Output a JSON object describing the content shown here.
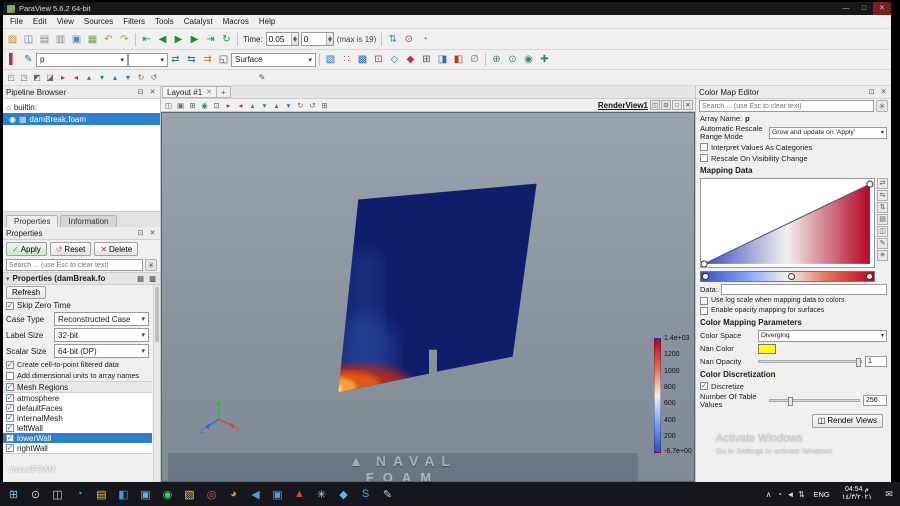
{
  "window": {
    "title": "ParaView 5.6.2 64-bit",
    "menus": [
      "File",
      "Edit",
      "View",
      "Sources",
      "Filters",
      "Tools",
      "Catalyst",
      "Macros",
      "Help"
    ]
  },
  "icons": {
    "minimize": "—",
    "maximize": "□",
    "close": "✕",
    "pin": "⊡",
    "gear": "✳",
    "collapse": "▾",
    "copy": "▤",
    "paste": "▥",
    "eye": "◉",
    "server": "⌂",
    "reader": "▦",
    "tab_close": "✕",
    "tab_plus": "+",
    "apply": "✓",
    "reset": "↺",
    "delete": "✕",
    "render_views": "◫",
    "naval_logo": "▲",
    "notification": "✉"
  },
  "toolbar1": {
    "file_icons": [
      {
        "name": "open-file-icon",
        "glyph": "▨",
        "color": "#c98a2c"
      },
      {
        "name": "save-data-icon",
        "glyph": "◫",
        "color": "#5b7fb4"
      },
      {
        "name": "save-state-icon",
        "glyph": "▤",
        "color": "#8a8a8a"
      },
      {
        "name": "load-state-icon",
        "glyph": "▥",
        "color": "#8a8a8a"
      },
      {
        "name": "save-screenshot-icon",
        "glyph": "▣",
        "color": "#4e86c8"
      },
      {
        "name": "save-animation-icon",
        "glyph": "▦",
        "color": "#76a23e"
      },
      {
        "name": "undo-icon",
        "glyph": "↶",
        "color": "#b9982e"
      },
      {
        "name": "redo-icon",
        "glyph": "↷",
        "color": "#b9982e"
      }
    ],
    "vcr_icons": [
      {
        "name": "first-frame-button",
        "glyph": "⇤",
        "color": "#1f8a3d"
      },
      {
        "name": "previous-frame-button",
        "glyph": "◀",
        "color": "#1f8a3d"
      },
      {
        "name": "play-button",
        "glyph": "▶",
        "color": "#1f8a3d"
      },
      {
        "name": "next-frame-button",
        "glyph": "▶",
        "color": "#1f8a3d"
      },
      {
        "name": "last-frame-button",
        "glyph": "⇥",
        "color": "#1f8a3d"
      },
      {
        "name": "loop-button",
        "glyph": "↻",
        "color": "#1f8a3d"
      }
    ],
    "time_label": "Time:",
    "time_value": "0.05",
    "frame_value": "0",
    "max_label": "(max is 19)",
    "extra_icons": [
      {
        "name": "snap-to-timesteps-icon",
        "glyph": "⇅",
        "color": "#4e86c8"
      },
      {
        "name": "find-data-icon",
        "glyph": "⊙",
        "color": "#b03a2e"
      },
      {
        "name": "time-inspector-icon",
        "glyph": "◔",
        "color": "#4e86c8"
      }
    ]
  },
  "toolbar2": {
    "left_icons": [
      {
        "name": "toggle-color-legend-icon",
        "glyph": "▌",
        "color": "#b03a2e"
      },
      {
        "name": "edit-color-map-icon",
        "glyph": "✎",
        "color": "#2e6db0"
      }
    ],
    "array_value": "p",
    "component_value": "",
    "scalarbar_icons": [
      {
        "name": "rescale-to-data-range-icon",
        "glyph": "⇄",
        "color": "#2e8b57"
      },
      {
        "name": "rescale-to-custom-range-icon",
        "glyph": "⇆",
        "color": "#2e6db0"
      },
      {
        "name": "rescale-over-time-icon",
        "glyph": "⇉",
        "color": "#b9772e"
      },
      {
        "name": "rescale-to-visible-range-icon",
        "glyph": "◱",
        "color": "#555555"
      }
    ],
    "representation_value": "Surface",
    "selection_icons": [
      {
        "name": "select-cells-on-surface-icon",
        "glyph": "▧",
        "color": "#2e6db0"
      },
      {
        "name": "select-points-on-surface-icon",
        "glyph": "∷",
        "color": "#b03a2e"
      },
      {
        "name": "select-cells-through-icon",
        "glyph": "▩",
        "color": "#2e6db0"
      },
      {
        "name": "select-points-through-icon",
        "glyph": "⊡",
        "color": "#b03a2e"
      },
      {
        "name": "select-cells-polygon-icon",
        "glyph": "◇",
        "color": "#2e6db0"
      },
      {
        "name": "select-points-polygon-icon",
        "glyph": "◆",
        "color": "#b03a2e"
      },
      {
        "name": "select-block-icon",
        "glyph": "⊞",
        "color": "#555555"
      },
      {
        "name": "interactive-select-cells-icon",
        "glyph": "◨",
        "color": "#2e6db0"
      },
      {
        "name": "interactive-select-points-icon",
        "glyph": "◧",
        "color": "#b03a2e"
      },
      {
        "name": "clear-selection-icon",
        "glyph": "∅",
        "color": "#777777"
      }
    ],
    "camera_icons": [
      {
        "name": "zoom-to-data-icon",
        "glyph": "⊕",
        "color": "#2e8b57"
      },
      {
        "name": "zoom-closest-icon",
        "glyph": "⊙",
        "color": "#2e8b57"
      },
      {
        "name": "reset-camera-icon",
        "glyph": "◉",
        "color": "#2e8b57"
      },
      {
        "name": "set-center-of-rotation-icon",
        "glyph": "✚",
        "color": "#2e8b57"
      }
    ]
  },
  "toolbar3": {
    "icons": [
      {
        "name": "camera-undo-icon",
        "glyph": "◰",
        "color": "#666666"
      },
      {
        "name": "camera-redo-icon",
        "glyph": "◳",
        "color": "#666666"
      },
      {
        "name": "interaction-mode-icon",
        "glyph": "◩",
        "color": "#666666"
      },
      {
        "name": "adjust-camera-icon",
        "glyph": "◪",
        "color": "#666666"
      },
      {
        "name": "plus-x-view-icon",
        "glyph": "▸",
        "color": "#b03a2e"
      },
      {
        "name": "minus-x-view-icon",
        "glyph": "◂",
        "color": "#b03a2e"
      },
      {
        "name": "plus-y-view-icon",
        "glyph": "▴",
        "color": "#2e8b57"
      },
      {
        "name": "minus-y-view-icon",
        "glyph": "▾",
        "color": "#2e8b57"
      },
      {
        "name": "plus-z-view-icon",
        "glyph": "▴",
        "color": "#2e6db0"
      },
      {
        "name": "minus-z-view-icon",
        "glyph": "▾",
        "color": "#2e6db0"
      },
      {
        "name": "rotate-90-cw-icon",
        "glyph": "↻",
        "color": "#666666"
      },
      {
        "name": "rotate-90-ccw-icon",
        "glyph": "↺",
        "color": "#666666"
      }
    ],
    "edit_icons": [
      {
        "name": "edit-color-legend-icon",
        "glyph": "✎",
        "color": "#555555"
      }
    ]
  },
  "pipeline": {
    "title": "Pipeline Browser",
    "builtin_label": "builtin:",
    "source_label": "damBreak.foam"
  },
  "panel_tabs": {
    "tab1": "Properties",
    "tab2": "Information"
  },
  "properties": {
    "title": "Properties",
    "apply_label": "Apply",
    "reset_label": "Reset",
    "delete_label": "Delete",
    "search_placeholder": "Search ... (use Esc to clear text)",
    "section_title": "Properties (damBreak.fo",
    "refresh_label": "Refresh",
    "skip_zero_time": "Skip Zero Time",
    "case_type_label": "Case Type",
    "case_type_value": "Reconstructed Case",
    "label_size_label": "Label Size",
    "label_size_value": "32-bit",
    "scalar_size_label": "Scalar Size",
    "scalar_size_value": "64-bit (DP)",
    "cell_to_point_label": "Create cell-to-point filtered data",
    "add_units_label": "Add dimensional units to array names",
    "mesh_regions_label": "Mesh Regions",
    "regions": [
      "atmosphere",
      "defaultFaces",
      "internalMesh",
      "leftWall",
      "lowerWall",
      "rightWall"
    ]
  },
  "layout": {
    "tab_label": "Layout #1",
    "view_label": "RenderView1",
    "view_icons": [
      {
        "name": "export-scene-icon",
        "glyph": "◫",
        "color": "#666666"
      },
      {
        "name": "capture-view-icon",
        "glyph": "▣",
        "color": "#666666"
      },
      {
        "name": "interaction-3d-icon",
        "glyph": "⊞",
        "color": "#666666"
      },
      {
        "name": "reset-camera-view-icon",
        "glyph": "◉",
        "color": "#2e8b57"
      },
      {
        "name": "zoom-to-box-icon",
        "glyph": "⊡",
        "color": "#666666"
      },
      {
        "name": "plus-x-camera-icon",
        "glyph": "▸",
        "color": "#b03a2e"
      },
      {
        "name": "minus-x-camera-icon",
        "glyph": "◂",
        "color": "#b03a2e"
      },
      {
        "name": "plus-y-camera-icon",
        "glyph": "▴",
        "color": "#2e8b57"
      },
      {
        "name": "minus-y-camera-icon",
        "glyph": "▾",
        "color": "#2e8b57"
      },
      {
        "name": "plus-z-camera-icon",
        "glyph": "▴",
        "color": "#2e6db0"
      },
      {
        "name": "minus-z-camera-icon",
        "glyph": "▾",
        "color": "#2e6db0"
      },
      {
        "name": "rotate-clockwise-icon",
        "glyph": "↻",
        "color": "#666666"
      },
      {
        "name": "rotate-counterclockwise-icon",
        "glyph": "↺",
        "color": "#666666"
      },
      {
        "name": "toggle-axes-grid-icon",
        "glyph": "⊞",
        "color": "#666666"
      }
    ],
    "view_buttons": [
      {
        "name": "split-horizontal-icon",
        "glyph": "◫"
      },
      {
        "name": "split-vertical-icon",
        "glyph": "⊟"
      },
      {
        "name": "maximize-view-icon",
        "glyph": "□"
      },
      {
        "name": "close-view-icon",
        "glyph": "✕"
      }
    ]
  },
  "viewport": {
    "legend": {
      "max": "1.4e+03",
      "ticks": [
        "1200",
        "1000",
        "800",
        "600",
        "400",
        "200"
      ],
      "min": "-6.7e+00"
    }
  },
  "watermarks": {
    "corner": "::/navalFOAM",
    "naval_line1": "NAVAL",
    "naval_line2": "FOAM",
    "win_line1": "Activate Windows",
    "win_line2": "Go to Settings to activate Windows"
  },
  "cme": {
    "title": "Color Map Editor",
    "search_placeholder": "Search ... (use Esc to clear text)",
    "array_name_label": "Array Name:",
    "array_name_value": "p",
    "rescale_mode_label": "Automatic Rescale Range Mode",
    "rescale_mode_value": "Grow and update on 'Apply'",
    "interpret_label": "Interpret Values As Categories",
    "rescale_visibility_label": "Rescale On Visibility Change",
    "mapping_data_label": "Mapping Data",
    "data_label": "Data:",
    "data_value": "",
    "log_scale_label": "Use log scale when mapping data to colors",
    "opacity_mapping_label": "Enable opacity mapping for surfaces",
    "color_mapping_params_label": "Color Mapping Parameters",
    "color_space_label": "Color Space",
    "color_space_value": "Diverging",
    "nan_color_label": "Nan Color",
    "nan_opacity_label": "Nan Opacity",
    "nan_opacity_value": "1",
    "color_discretization_label": "Color Discretization",
    "discretize_label": "Discretize",
    "table_values_label": "Number Of Table Values",
    "table_values_value": "256",
    "render_views_label": "Render Views",
    "tool_icons": [
      {
        "name": "rescale-range-icon",
        "glyph": "⇄"
      },
      {
        "name": "rescale-custom-range-icon",
        "glyph": "⇆"
      },
      {
        "name": "invert-colors-icon",
        "glyph": "⇅"
      },
      {
        "name": "choose-preset-icon",
        "glyph": "▤"
      },
      {
        "name": "save-preset-icon",
        "glyph": "◫"
      },
      {
        "name": "manual-edit-icon",
        "glyph": "✎"
      },
      {
        "name": "advanced-options-icon",
        "glyph": "✳"
      }
    ]
  },
  "colors": {
    "accent": "#2f7fd0",
    "dam": "#101d6b",
    "legend_top": "#b40426",
    "legend_mid": "#f2f0ee",
    "legend_bottom": "#3b4cc0",
    "nan_color": "#ffff00",
    "apply_green": "#2f9e44"
  },
  "taskbar": {
    "icons": [
      {
        "name": "start-button",
        "glyph": "⊞",
        "color": "#6ec6f0"
      },
      {
        "name": "search-button",
        "glyph": "⊙",
        "color": "#d0d0d0"
      },
      {
        "name": "task-view-button",
        "glyph": "◫",
        "color": "#d0d0d0"
      },
      {
        "name": "edge-icon",
        "glyph": "◔",
        "color": "#35a3d8"
      },
      {
        "name": "explorer-icon",
        "glyph": "▤",
        "color": "#e8c33a"
      },
      {
        "name": "vscode-icon",
        "glyph": "◧",
        "color": "#3b9ae1"
      },
      {
        "name": "store-icon",
        "glyph": "▣",
        "color": "#58b7e8"
      },
      {
        "name": "whatsapp-icon",
        "glyph": "◉",
        "color": "#3ed364"
      },
      {
        "name": "folder-icon",
        "glyph": "▧",
        "color": "#e8c33a"
      },
      {
        "name": "chrome-icon",
        "glyph": "◎",
        "color": "#e05a4e"
      },
      {
        "name": "firefox-icon",
        "glyph": "◕",
        "color": "#f08a24"
      },
      {
        "name": "telegram-icon",
        "glyph": "◀",
        "color": "#38a6dd"
      },
      {
        "name": "photos-icon",
        "glyph": "▣",
        "color": "#4aa3e0"
      },
      {
        "name": "acrobat-icon",
        "glyph": "▲",
        "color": "#e0443a"
      },
      {
        "name": "settings-icon",
        "glyph": "✳",
        "color": "#d0d0d0"
      },
      {
        "name": "paraview-icon",
        "glyph": "◆",
        "color": "#58c0d8"
      },
      {
        "name": "skype-icon",
        "glyph": "S",
        "color": "#45b1e8"
      },
      {
        "name": "snipping-icon",
        "glyph": "✎",
        "color": "#d0d0d0"
      }
    ],
    "tray_icons": [
      {
        "name": "tray-expand-icon",
        "glyph": "∧"
      },
      {
        "name": "onedrive-icon",
        "glyph": "◔"
      },
      {
        "name": "volume-icon",
        "glyph": "◄"
      },
      {
        "name": "network-icon",
        "glyph": "⇅"
      }
    ],
    "language": "ENG",
    "time": "04:54 م",
    "date": "١٤/٣/٢٠٢١"
  }
}
